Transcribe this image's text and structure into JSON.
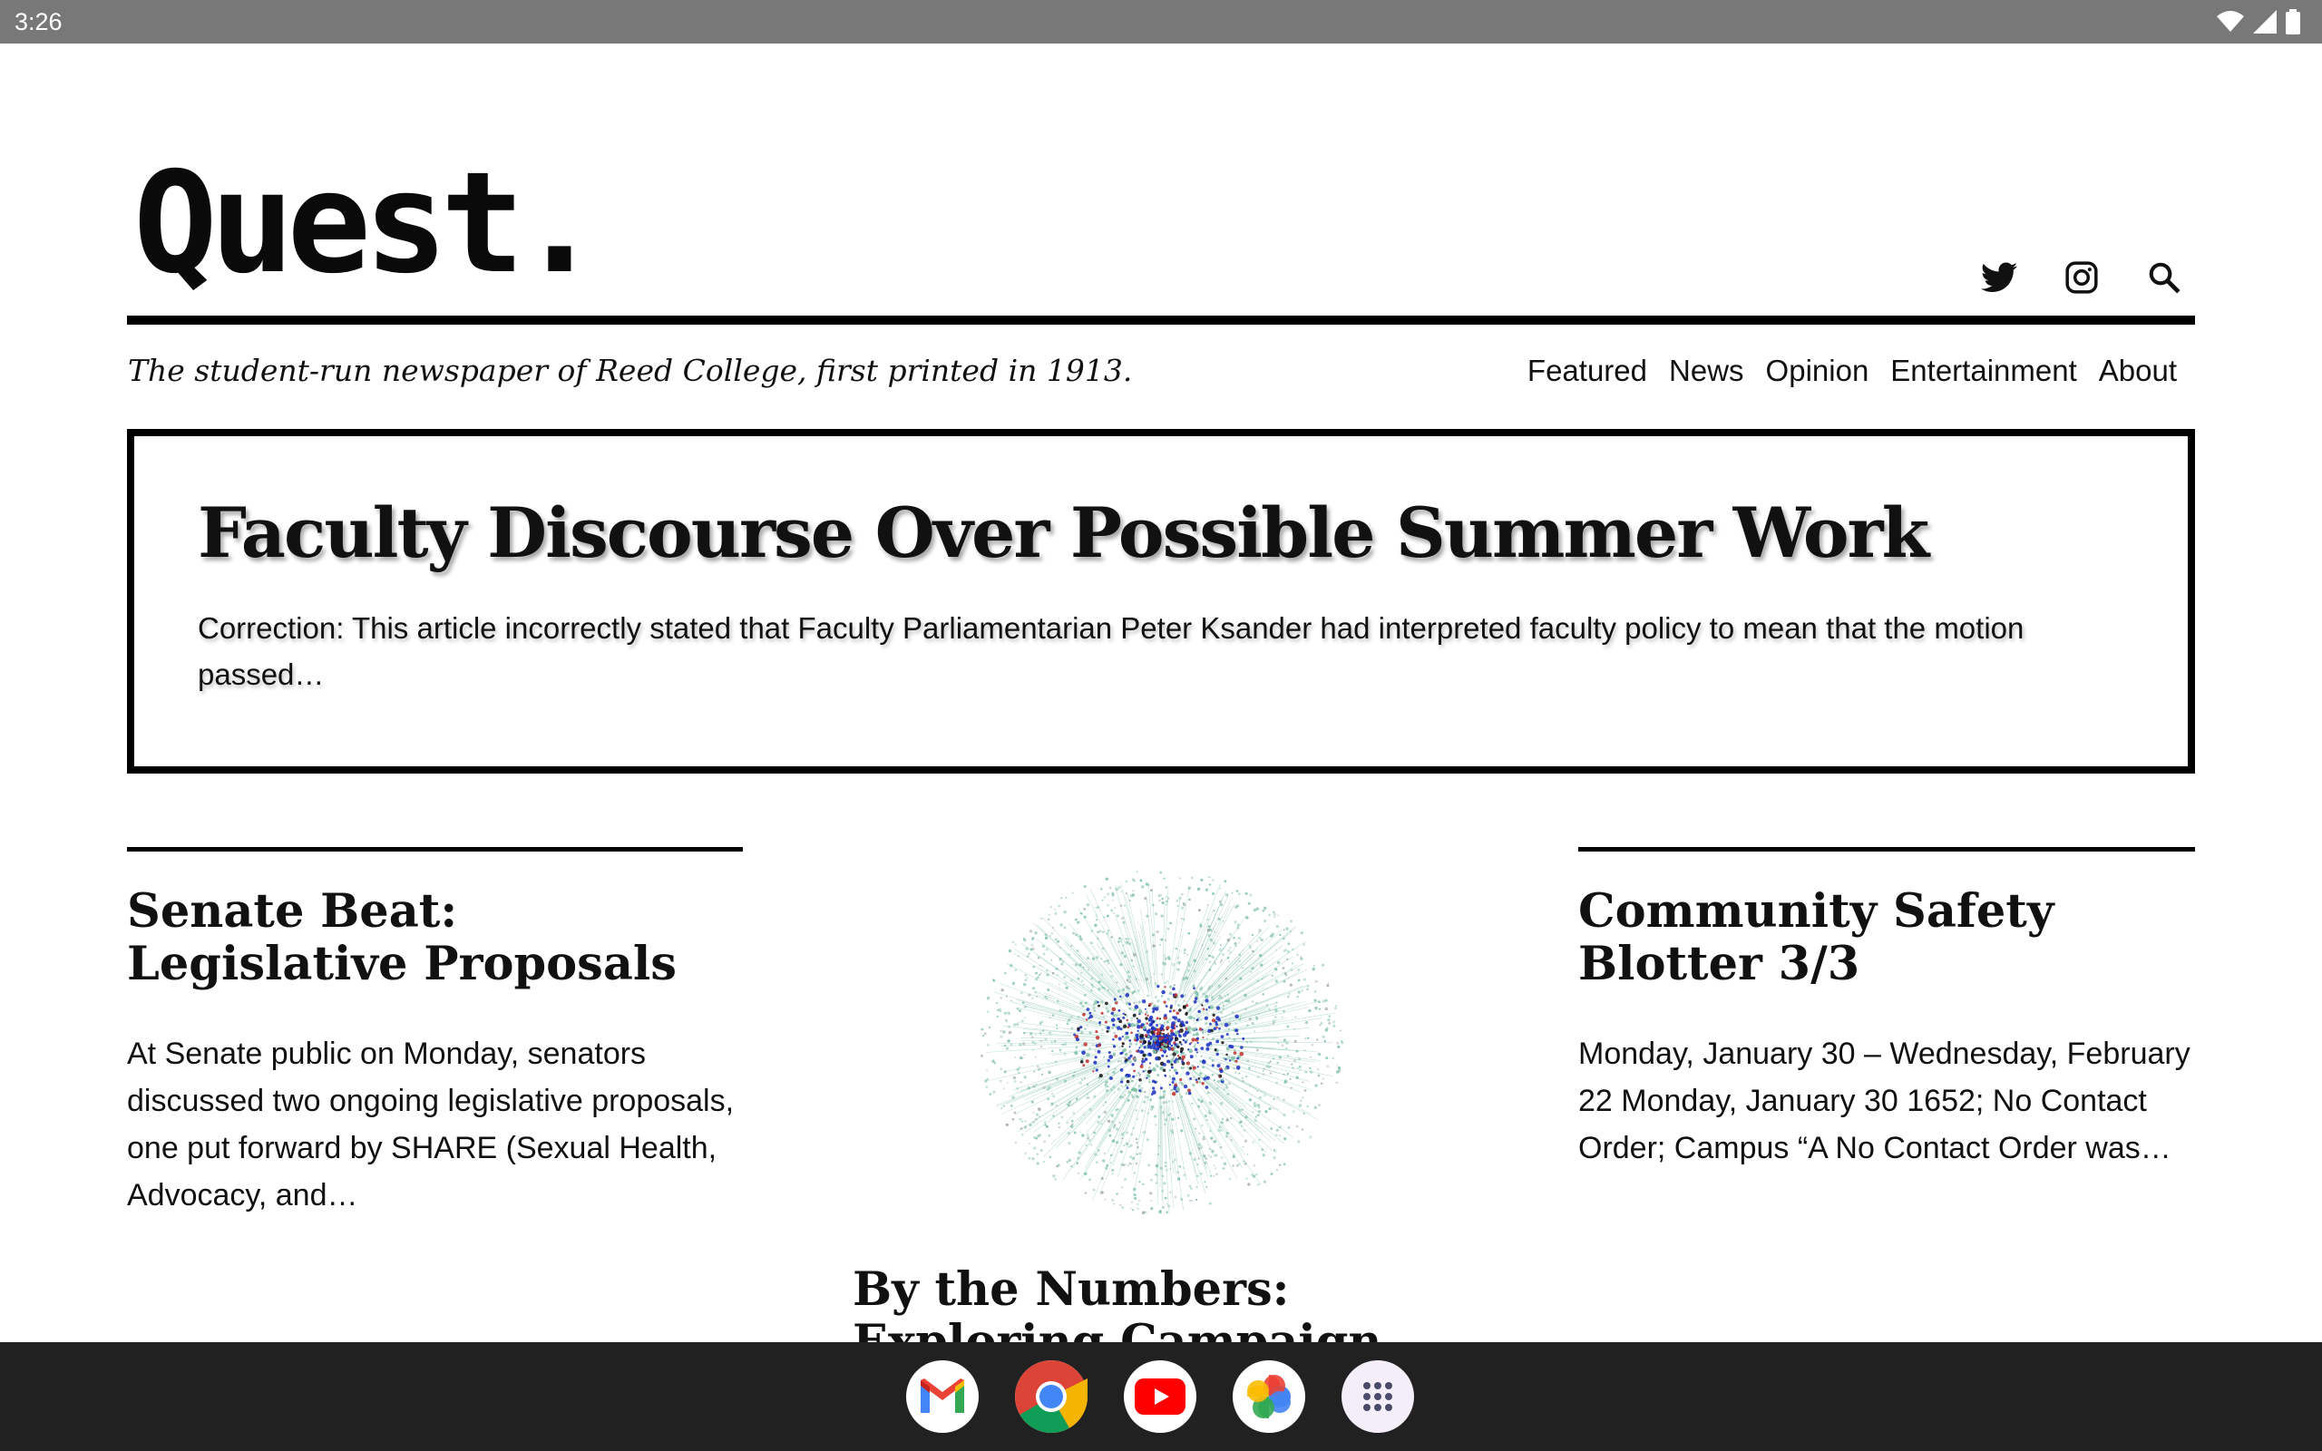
{
  "status_bar": {
    "time": "3:26",
    "icons": [
      "wifi-icon",
      "signal-icon",
      "battery-icon"
    ]
  },
  "masthead": {
    "logo_text": "Quest.",
    "tagline": "The student-run newspaper of Reed College, first printed in 1913.",
    "social_icons": [
      "twitter-icon",
      "instagram-icon",
      "search-icon"
    ]
  },
  "nav": {
    "items": [
      {
        "label": "Featured"
      },
      {
        "label": "News"
      },
      {
        "label": "Opinion"
      },
      {
        "label": "Entertainment"
      },
      {
        "label": "About"
      }
    ]
  },
  "featured": {
    "title": "Faculty Discourse Over Possible Summer Work",
    "excerpt": "Correction: This article incorrectly stated that Faculty Parliamentarian Peter Ksander had interpreted faculty policy to mean that the motion passed…"
  },
  "articles": [
    {
      "title": "Senate Beat: Legislative Proposals",
      "excerpt": "At Senate public on Monday, senators discussed two ongoing legislative proposals, one put forward by SHARE (Sexual Health, Advocacy, and…"
    },
    {
      "title": "By the Numbers: Exploring Campaign",
      "image": "network-graph-image"
    },
    {
      "title": "Community Safety Blotter 3/3",
      "excerpt": "Monday, January 30 – Wednesday, February 22 Monday, January 30 1652; No Contact Order; Campus “A No Contact Order was…"
    }
  ],
  "dock": {
    "apps": [
      "gmail-icon",
      "chrome-icon",
      "youtube-icon",
      "photos-icon",
      "app-drawer-icon"
    ]
  },
  "colors": {
    "status_bar": "#787878",
    "dock": "#212121",
    "text": "#111111",
    "network_green": "#7fbfa6",
    "network_blue": "#1a2fbf",
    "network_red": "#c03030"
  }
}
